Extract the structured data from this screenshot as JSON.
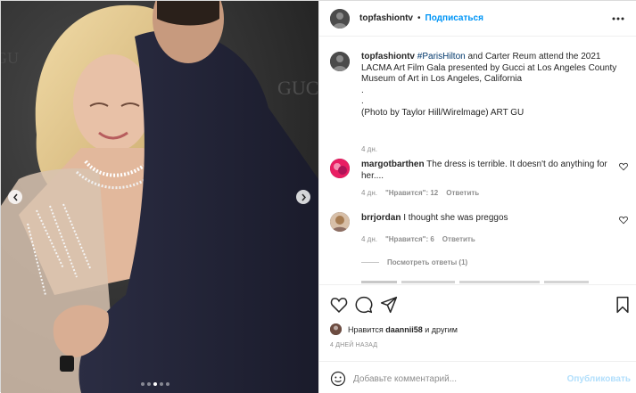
{
  "post": {
    "author": "topfashiontv",
    "follow_label": "Подписаться",
    "separator": "•"
  },
  "caption": {
    "username": "topfashiontv",
    "hashtag": "#ParisHilton",
    "text": "and Carter Reum attend the 2021 LACMA Art Film Gala presented by Gucci at Los Angeles County Museum of Art in Los Angeles, California",
    "dot1": ".",
    "dot2": ".",
    "credit": "(Photo by Taylor Hill/Wirelmage) ART GU",
    "time": "4 дн."
  },
  "comments": [
    {
      "username": "margotbarthen",
      "text": "The dress is terrible. It doesn't do anything for her....",
      "time": "4 дн.",
      "likes": "\"Нравится\": 12",
      "reply": "Ответить",
      "avatar_color": "#c2185b"
    },
    {
      "username": "brrjordan",
      "text": "I thought she was preggos",
      "time": "4 дн.",
      "likes": "\"Нравится\": 6",
      "reply": "Ответить",
      "avatar_color": "#b9926f"
    }
  ],
  "view_replies": "Посмотреть ответы (1)",
  "likes_line": {
    "prefix": "Нравится",
    "user": "daannii58",
    "suffix": "и другим"
  },
  "posted_ago": "4 ДНЕЙ НАЗАД",
  "add_comment": {
    "placeholder": "Добавьте комментарий...",
    "post_label": "Опубликовать"
  },
  "carousel": {
    "slides": 5,
    "active": 3
  },
  "colors": {
    "accent": "#0095f6",
    "post_disabled": "#b2dffc",
    "muted": "#8e8e8e"
  },
  "icons": [
    "chevron-left-icon",
    "chevron-right-icon",
    "more-icon",
    "heart-icon",
    "comment-icon",
    "share-icon",
    "bookmark-icon",
    "emoji-icon"
  ]
}
